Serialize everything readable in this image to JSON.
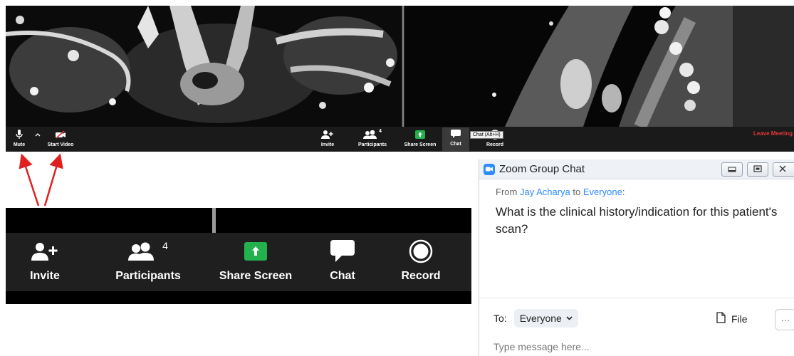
{
  "meeting_toolbar": {
    "mute_label": "Mute",
    "start_video_label": "Start Video",
    "invite_label": "Invite",
    "participants_label": "Participants",
    "participants_count": "4",
    "share_screen_label": "Share Screen",
    "chat_label": "Chat",
    "record_label": "Record",
    "chat_tooltip": "Chat (Alt+H)",
    "leave_label": "Leave Meeting"
  },
  "zoomed_toolbar": {
    "invite_label": "Invite",
    "participants_label": "Participants",
    "participants_count": "4",
    "share_screen_label": "Share Screen",
    "chat_label": "Chat",
    "record_label": "Record"
  },
  "chat": {
    "window_title": "Zoom Group Chat",
    "message": {
      "from_prefix": "From",
      "sender": "Jay Acharya",
      "to_word": "to",
      "recipient": "Everyone",
      "colon": ":",
      "text": "What is the clinical history/indication for this patient's scan?"
    },
    "compose": {
      "to_label": "To:",
      "to_value": "Everyone",
      "file_label": "File",
      "more_label": "···",
      "placeholder": "Type message here..."
    }
  },
  "colors": {
    "share_green": "#23b14d",
    "zoom_blue": "#2d8cff",
    "leave_red": "#e5363b",
    "toolbar_dark": "#1f1f1f"
  }
}
